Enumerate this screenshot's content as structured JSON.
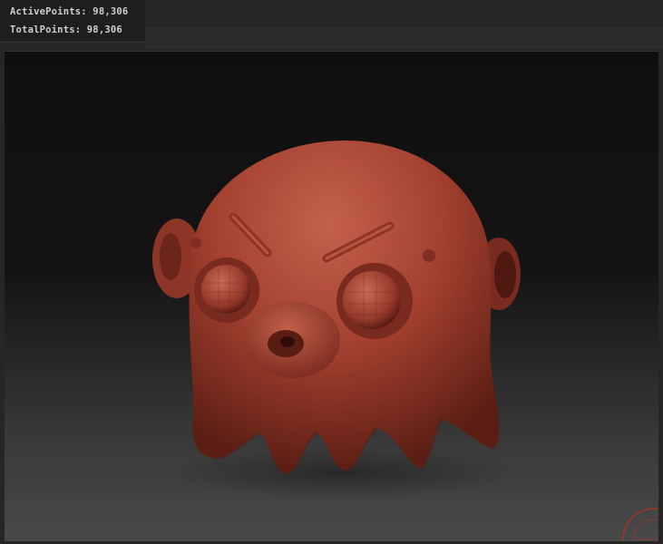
{
  "stats": {
    "active_points": "ActivePoints: 98,306",
    "total_points": "TotalPoints: 98,306"
  },
  "model": {
    "material_color": "#a3402f",
    "highlight_color": "#c96a55",
    "shadow_color": "#5a1d14"
  },
  "icons": {
    "navigation_gizmo": "red-circle-gizmo"
  }
}
